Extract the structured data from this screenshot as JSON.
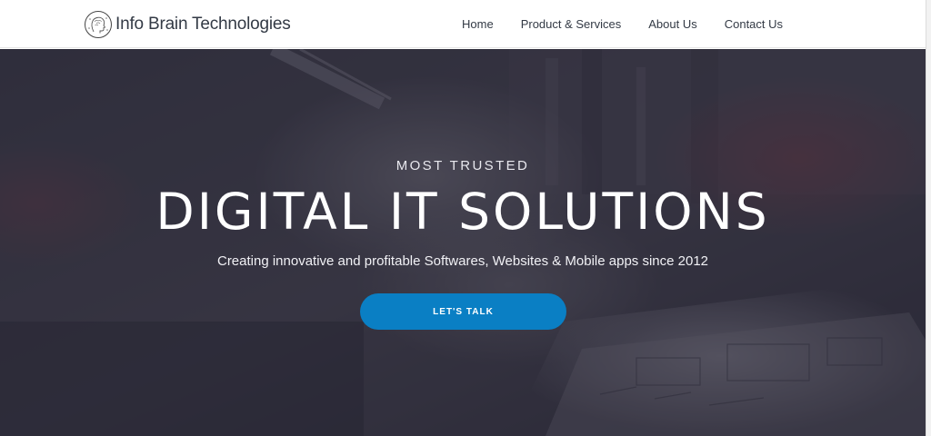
{
  "header": {
    "brand": "Info Brain Technologies",
    "logo_icon": "brain-head-icon",
    "nav": [
      {
        "label": "Home"
      },
      {
        "label": "Product & Services"
      },
      {
        "label": "About Us"
      },
      {
        "label": "Contact Us"
      }
    ]
  },
  "hero": {
    "kicker": "MOST TRUSTED",
    "title": "DIGITAL IT SOLUTIONS",
    "subtitle": "Creating innovative and profitable Softwares, Websites & Mobile apps since 2012",
    "cta_label": "LET'S TALK",
    "background_subject": "blurred photo of a hand writing on a paper sketch",
    "background_icon": "hero-photo-icon"
  },
  "colors": {
    "header_bg": "#ffffff",
    "nav_text": "#333a45",
    "hero_overlay": "#262534",
    "cta_bg": "#0a7fc4",
    "cta_text": "#ffffff",
    "hero_text": "#ffffff"
  }
}
